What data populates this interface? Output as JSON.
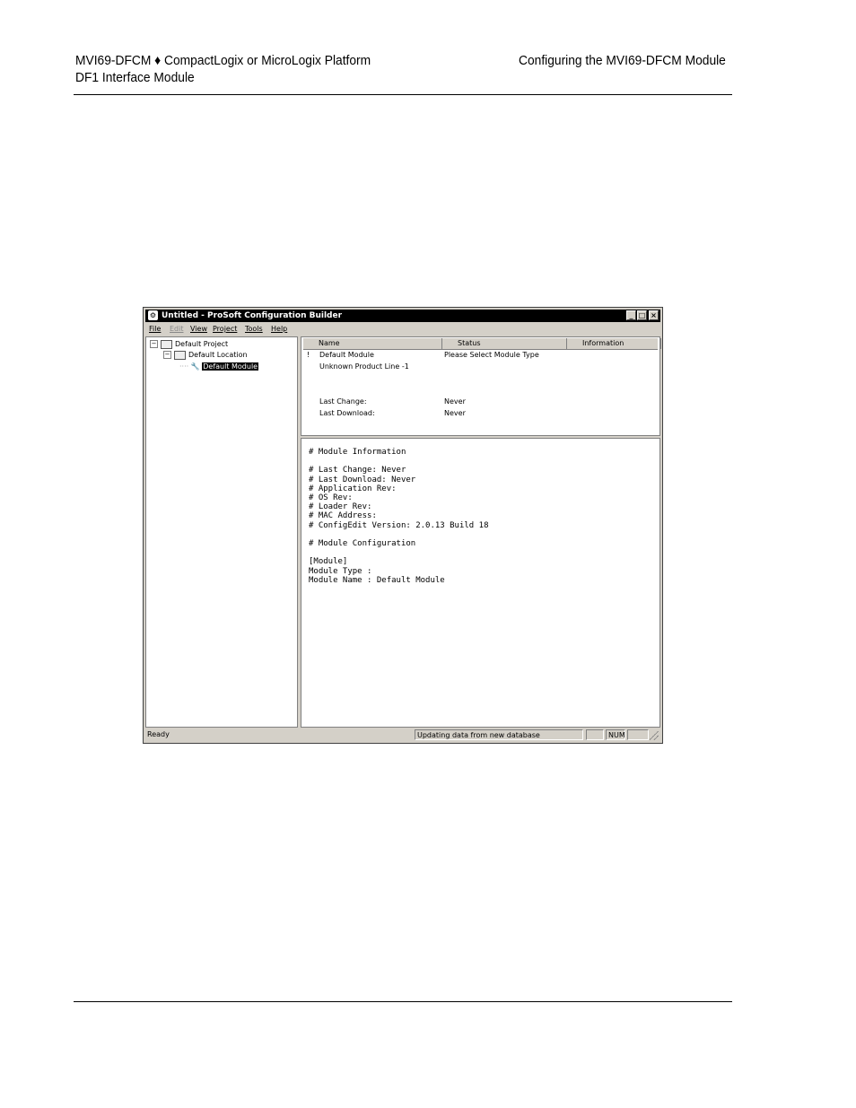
{
  "header": {
    "left_line1": "MVI69-DFCM ♦ CompactLogix or MicroLogix Platform",
    "left_line2": "DF1 Interface Module",
    "right": "Configuring the MVI69-DFCM Module"
  },
  "window": {
    "title": "Untitled - ProSoft Configuration Builder",
    "menu": [
      {
        "label": "File",
        "enabled": true
      },
      {
        "label": "Edit",
        "enabled": false
      },
      {
        "label": "View",
        "enabled": true
      },
      {
        "label": "Project",
        "enabled": true
      },
      {
        "label": "Tools",
        "enabled": true
      },
      {
        "label": "Help",
        "enabled": true
      }
    ],
    "buttons": {
      "minimize": "_",
      "maximize": "□",
      "close": "×"
    }
  },
  "tree": {
    "project": "Default Project",
    "location": "Default Location",
    "module": "Default Module"
  },
  "info_panel": {
    "columns": [
      "Name",
      "Status",
      "Information"
    ],
    "module_name": "Default Module",
    "module_status": "Please Select Module Type",
    "product_line": "Unknown Product Line -1",
    "last_change_label": "Last Change:",
    "last_change_value": "Never",
    "last_download_label": "Last Download:",
    "last_download_value": "Never"
  },
  "config_text": "# Module Information\n\n# Last Change: Never\n# Last Download: Never\n# Application Rev:\n# OS Rev:\n# Loader Rev:\n# MAC Address:\n# ConfigEdit Version: 2.0.13 Build 18\n\n# Module Configuration\n\n[Module]\nModule Type :\nModule Name : Default Module",
  "statusbar": {
    "ready": "Ready",
    "message": "Updating data from new database",
    "num": "NUM"
  }
}
